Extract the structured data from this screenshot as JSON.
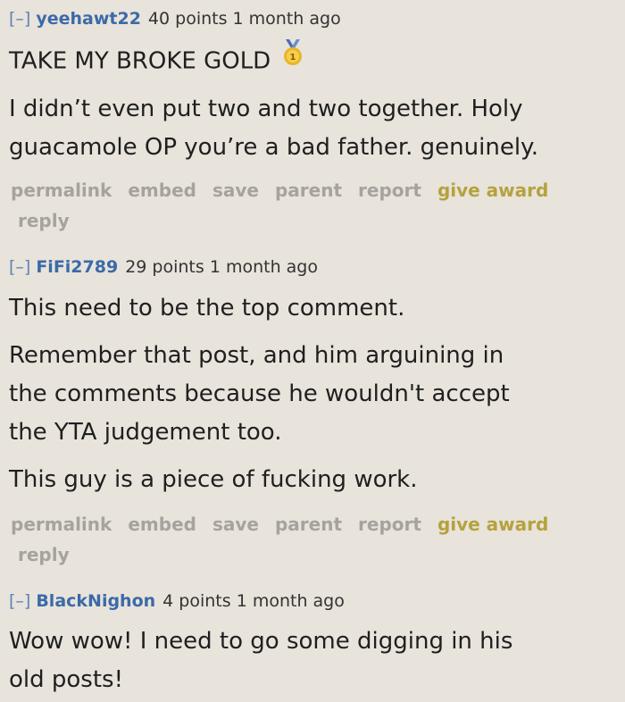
{
  "comments": [
    {
      "collapse": "[–]",
      "author": "yeehawt22",
      "score_time": "40 points 1 month ago",
      "lines": [
        "TAKE MY BROKE GOLD",
        "I didn’t even put two and two together. Holy",
        "guacamole OP you’re a bad father. genuinely."
      ],
      "award_icon": "gold-medal-icon"
    },
    {
      "collapse": "[–]",
      "author": "FiFi2789",
      "score_time": "29 points 1 month ago",
      "lines": [
        "This need to be the top comment.",
        "Remember that post, and him arguining in",
        "the comments because he wouldn't accept",
        "the YTA judgement too.",
        "This guy is a piece of fucking work."
      ]
    },
    {
      "collapse": "[–]",
      "author": "BlackNighon",
      "score_time": "4 points 1 month ago",
      "lines": [
        "Wow wow! I need to go some digging in his",
        "old posts!"
      ]
    }
  ],
  "buttons": {
    "permalink": "permalink",
    "embed": "embed",
    "save": "save",
    "parent": "parent",
    "report": "report",
    "give_award": "give award",
    "reply": "reply"
  },
  "colors": {
    "background": "#e8e3db",
    "author": "#3b6aa8",
    "button": "#a6a39e",
    "award": "#b5a23d"
  }
}
